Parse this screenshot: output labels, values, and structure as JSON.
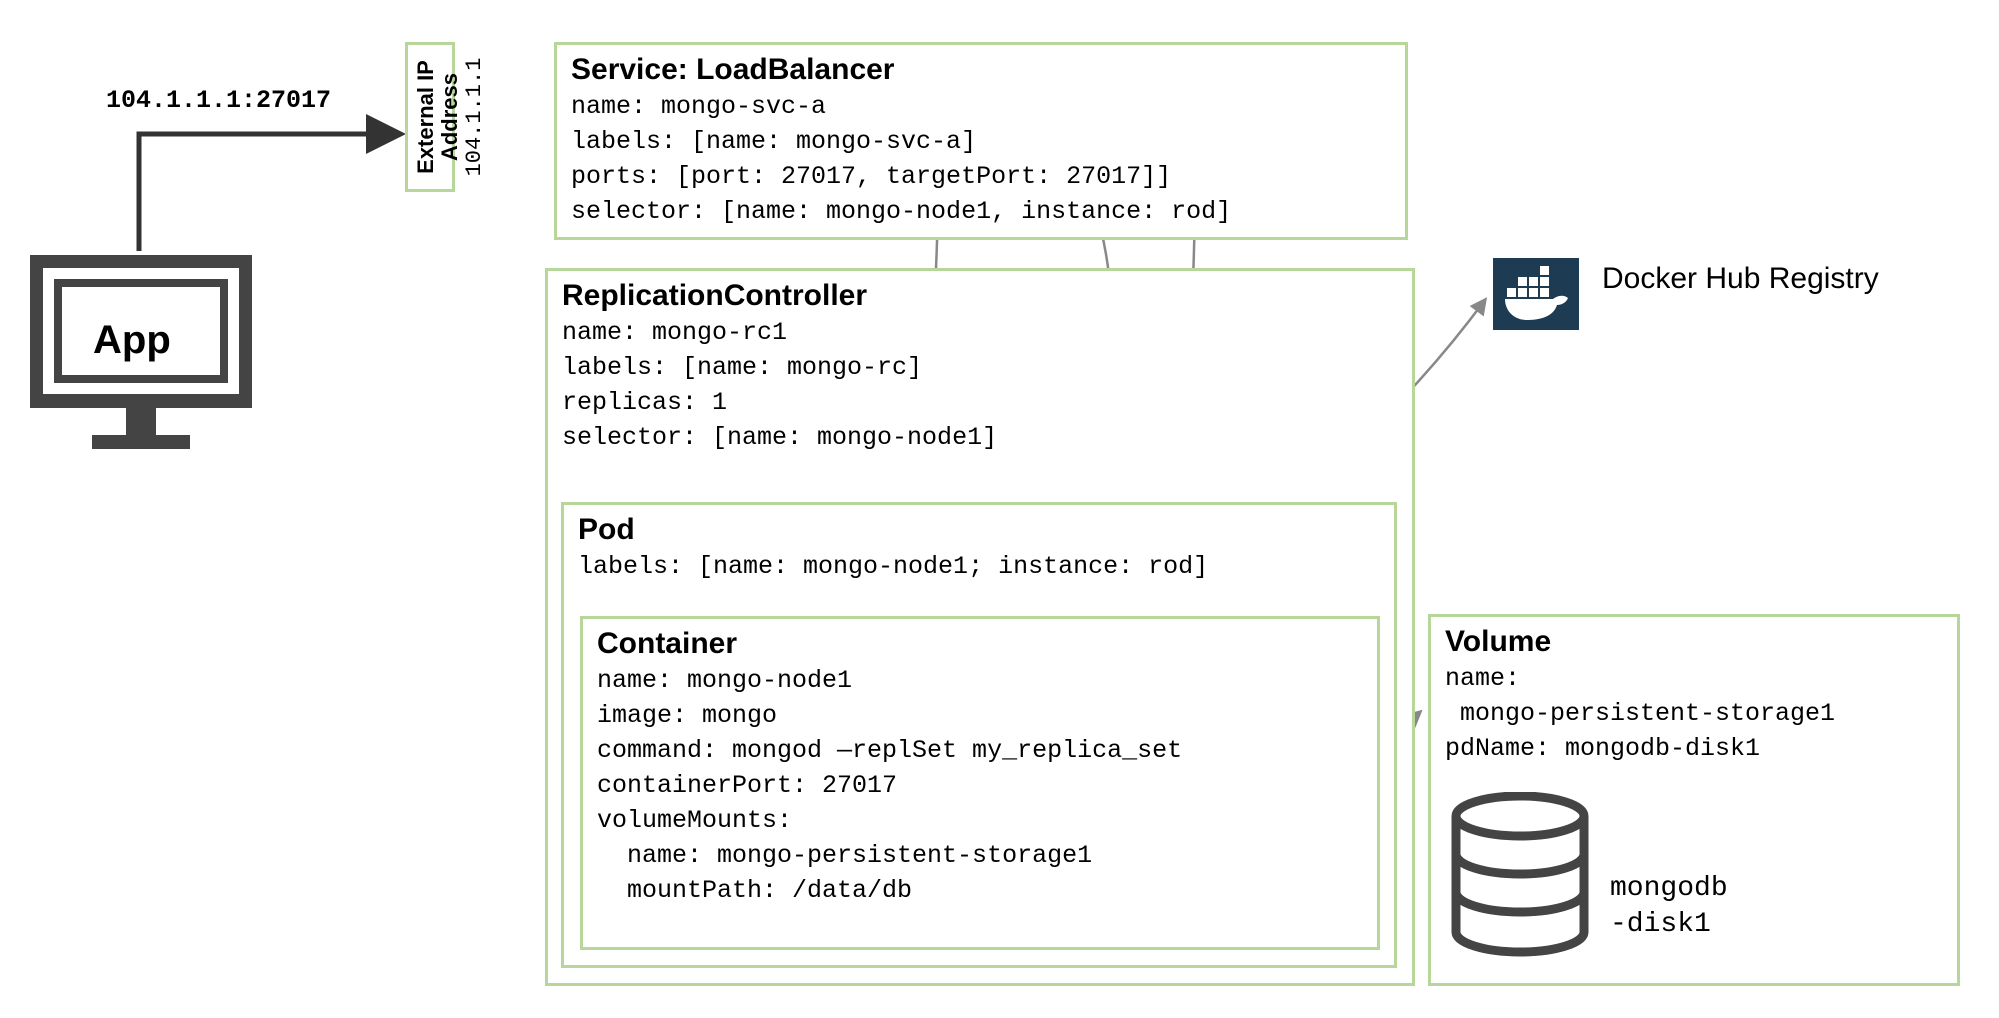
{
  "app": {
    "label": "App"
  },
  "ip_label": "104.1.1.1:27017",
  "external_ip": {
    "title": "External IP Address",
    "value": "104.1.1.1"
  },
  "service": {
    "title": "Service: LoadBalancer",
    "name_line": "name: mongo-svc-a",
    "labels_line": "labels: [name: mongo-svc-a]",
    "ports_line": "ports: [port: 27017, targetPort: 27017]]",
    "selector_line": "selector: [name: mongo-node1, instance: rod]"
  },
  "rc": {
    "title": "ReplicationController",
    "name_line": "name: mongo-rc1",
    "labels_line": "labels: [name: mongo-rc]",
    "replicas_line": "replicas: 1",
    "selector_line": "selector: [name: mongo-node1]"
  },
  "pod": {
    "title": "Pod",
    "labels_line": "labels: [name: mongo-node1; instance: rod]"
  },
  "container": {
    "title": "Container",
    "name_line": "name: mongo-node1",
    "image_line": "image: mongo",
    "command_line": "command: mongod —replSet my_replica_set",
    "port_line": "containerPort: 27017",
    "vm_title": "volumeMounts:",
    "vm_name": "  name: mongo-persistent-storage1",
    "vm_path": "  mountPath: /data/db"
  },
  "docker": {
    "label": "Docker Hub Registry"
  },
  "volume": {
    "title": "Volume",
    "name_key": "name:",
    "name_val": " mongo-persistent-storage1",
    "pdname_line": "pdName: mongodb-disk1",
    "disk_label": "mongodb\n-disk1"
  }
}
